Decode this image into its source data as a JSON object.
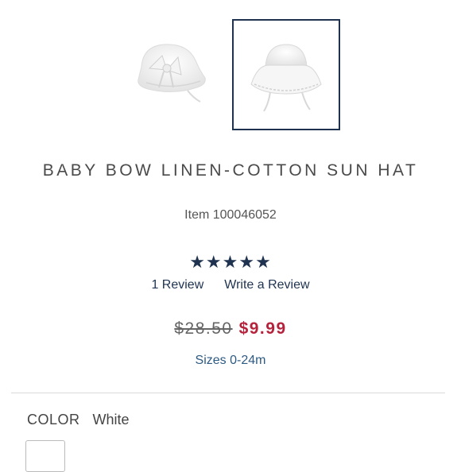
{
  "product": {
    "title": "BABY BOW LINEN-COTTON SUN HAT",
    "item_number": "Item 100046052",
    "rating_stars": "★★★★★",
    "rating": 5,
    "review_count_label": "1 Review",
    "write_review_label": "Write a Review",
    "original_price": "$28.50",
    "sale_price": "$9.99",
    "sizes": "Sizes 0-24m",
    "color_label": "COLOR",
    "color_value": "White"
  },
  "colors": {
    "navy": "#1f3350",
    "sale_red": "#b5223c",
    "link_blue": "#2d5a83"
  },
  "gallery": {
    "selected_index": 1,
    "images": [
      {
        "icon": "hat-with-bow-image"
      },
      {
        "icon": "hat-front-image"
      }
    ]
  }
}
